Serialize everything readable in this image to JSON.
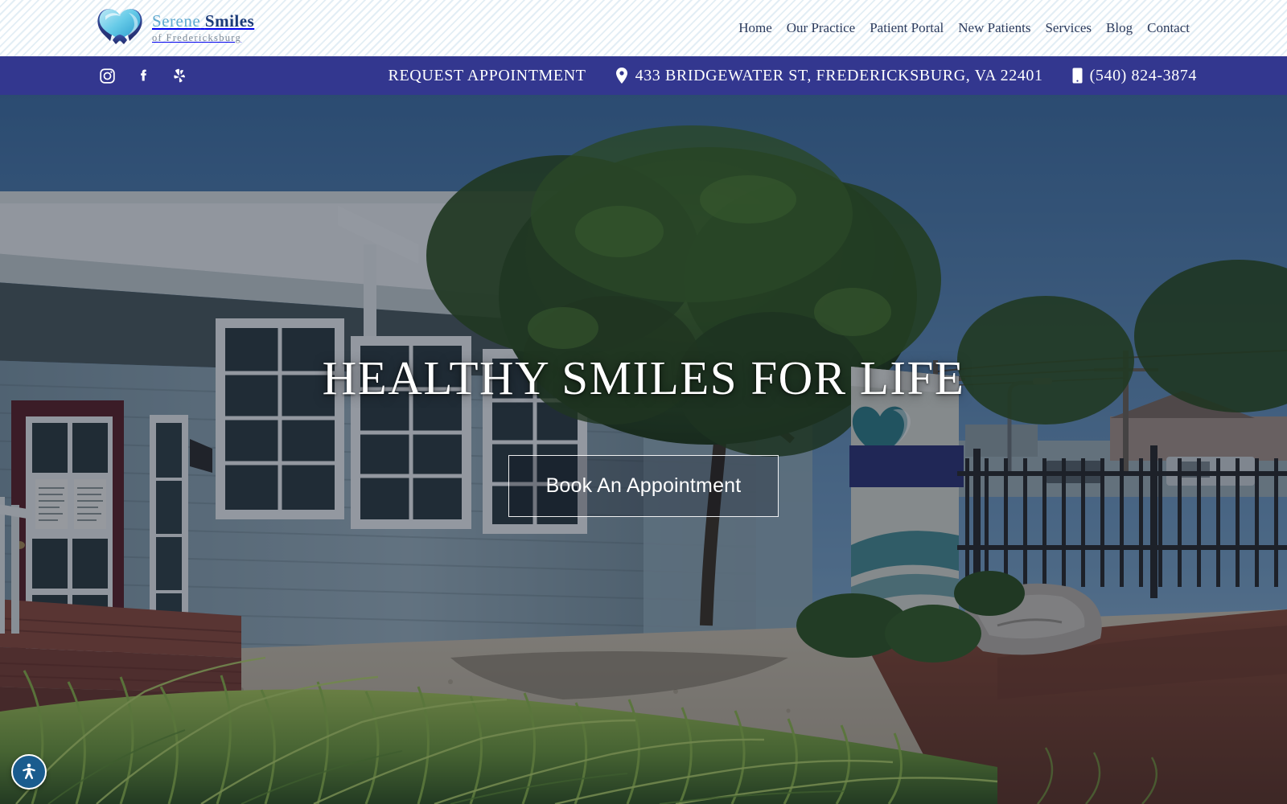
{
  "header": {
    "logo": {
      "icon": "tooth-heart-logo",
      "name_part1": "Serene",
      "name_part2": "Smiles",
      "tagline": "of Fredericksburg"
    },
    "nav": [
      {
        "label": "Home",
        "name": "nav-home"
      },
      {
        "label": "Our Practice",
        "name": "nav-our-practice"
      },
      {
        "label": "Patient Portal",
        "name": "nav-patient-portal"
      },
      {
        "label": "New Patients",
        "name": "nav-new-patients"
      },
      {
        "label": "Services",
        "name": "nav-services"
      },
      {
        "label": "Blog",
        "name": "nav-blog"
      },
      {
        "label": "Contact",
        "name": "nav-contact"
      }
    ]
  },
  "contact_bar": {
    "background_color": "#33378f",
    "socials": [
      {
        "label": "Instagram",
        "icon": "instagram-icon"
      },
      {
        "label": "Facebook",
        "icon": "facebook-icon"
      },
      {
        "label": "Yelp",
        "icon": "yelp-icon"
      }
    ],
    "request_appointment": "REQUEST APPOINTMENT",
    "address": "433 BRIDGEWATER ST, FREDERICKSBURG, VA 22401",
    "address_icon": "map-pin-icon",
    "phone": "(540) 824-3874",
    "phone_icon": "mobile-phone-icon"
  },
  "hero": {
    "heading": "HEALTHY SMILES FOR LIFE",
    "cta_label": "Book An Appointment",
    "image_description": "Exterior of the dental office: blue-gray clapboard house with white trim, dark red front door, large shade tree, monument sign with Serene Smiles logo, gravel path, green ornamental grasses and red mulch beds",
    "overlay_color": "#111829"
  },
  "accessibility_widget": {
    "label": "Accessibility options",
    "icon": "accessibility-person-icon",
    "color": "#1a5c8e"
  }
}
